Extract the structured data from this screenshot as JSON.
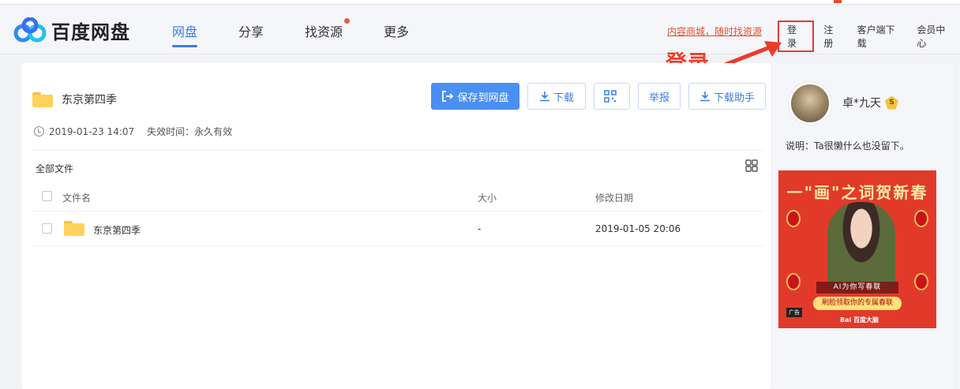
{
  "header": {
    "logo_text": "百度网盘",
    "nav": [
      {
        "label": "网盘",
        "active": true
      },
      {
        "label": "分享",
        "active": false
      },
      {
        "label": "找资源",
        "active": false,
        "dot": true
      },
      {
        "label": "更多",
        "active": false
      }
    ],
    "promo": "内容商城，随时找资源",
    "links": {
      "login": "登录",
      "register": "注册",
      "client_download": "客户端下载",
      "member_center": "会员中心"
    }
  },
  "annotation": {
    "text": "登录",
    "color": "#ec3b2c"
  },
  "share": {
    "title": "东京第四季",
    "created": "2019-01-23 14:07",
    "expire": "失效时间：永久有效",
    "actions": {
      "save": "保存到网盘",
      "download": "下载",
      "report": "举报",
      "download_helper": "下载助手"
    }
  },
  "files": {
    "breadcrumb": "全部文件",
    "columns": {
      "name": "文件名",
      "size": "大小",
      "date": "修改日期"
    },
    "rows": [
      {
        "name": "东京第四季",
        "size": "-",
        "date": "2019-01-05 20:06"
      }
    ]
  },
  "sidebar": {
    "user_name": "卓*九天",
    "badge": "S",
    "description": "说明：Ta很懒什么也没留下。",
    "ad": {
      "headline": "一\"画\"之词贺新春",
      "line1": "AI为你写春联",
      "line2": "刷脸领取你的专属春联",
      "tag": "广告",
      "brand": "Bai 百度大脑"
    }
  },
  "colors": {
    "accent": "#3a7ee8",
    "primary_button": "#4a8ff3",
    "highlight_red": "#e53935"
  }
}
